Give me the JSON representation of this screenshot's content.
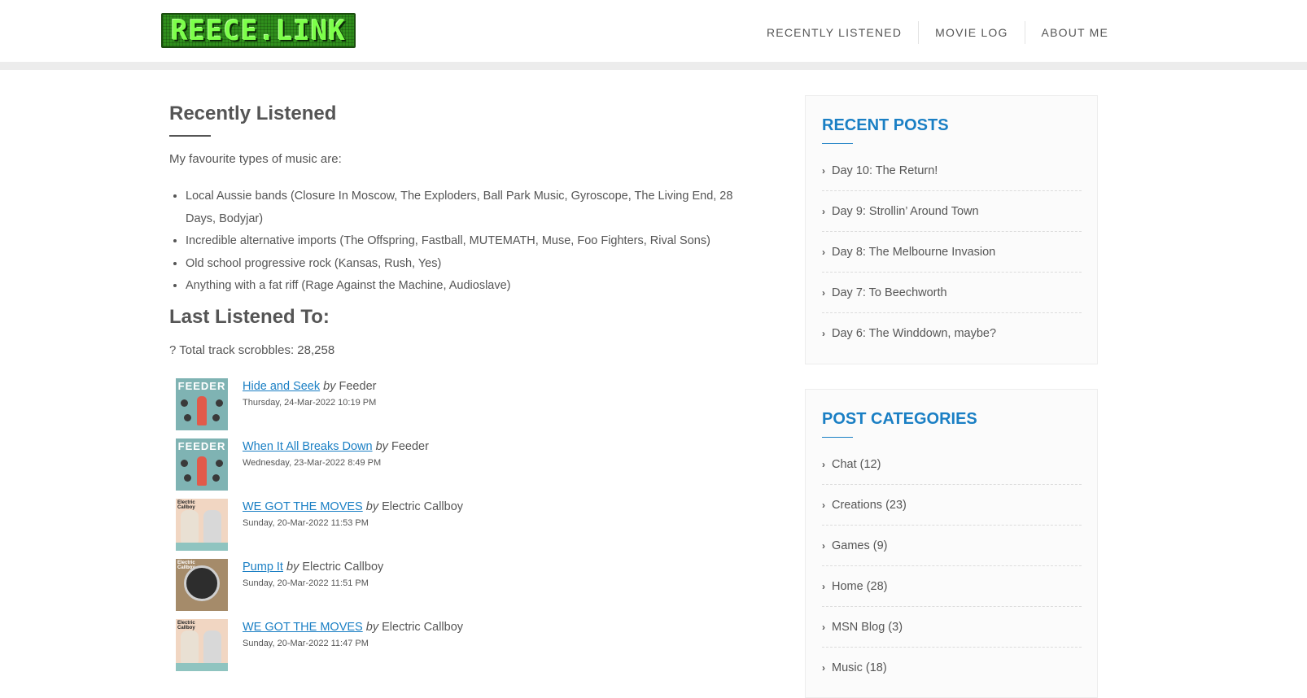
{
  "site": {
    "logo_text": "REECE.LINK"
  },
  "nav": [
    {
      "label": "RECENTLY LISTENED"
    },
    {
      "label": "MOVIE LOG"
    },
    {
      "label": "ABOUT ME"
    }
  ],
  "main": {
    "title": "Recently Listened",
    "intro": "My favourite types of music are:",
    "genres": [
      "Local Aussie bands (Closure In Moscow, The Exploders, Ball Park Music, Gyroscope, The Living End, 28 Days, Bodyjar)",
      "Incredible alternative imports (The Offspring, Fastball, MUTEMATH, Muse, Foo Fighters, Rival Sons)",
      "Old school progressive rock (Kansas, Rush, Yes)",
      "Anything with a fat riff (Rage Against the Machine, Audioslave)"
    ],
    "last_title": "Last Listened To:",
    "scrobbles": "? Total track scrobbles: 28,258",
    "by_word": "by",
    "tracks": [
      {
        "title": "Hide and Seek",
        "artist": "Feeder",
        "date": "Thursday, 24-Mar-2022 10:19 PM",
        "art": "feeder-album-art"
      },
      {
        "title": "When It All Breaks Down",
        "artist": "Feeder",
        "date": "Wednesday, 23-Mar-2022 8:49 PM",
        "art": "feeder-album-art"
      },
      {
        "title": "WE GOT THE MOVES",
        "artist": "Electric Callboy",
        "date": "Sunday, 20-Mar-2022 11:53 PM",
        "art": "electric-callboy-album-art"
      },
      {
        "title": "Pump It",
        "artist": "Electric Callboy",
        "date": "Sunday, 20-Mar-2022 11:51 PM",
        "art": "electric-callboy-pump-it-art"
      },
      {
        "title": "WE GOT THE MOVES",
        "artist": "Electric Callboy",
        "date": "Sunday, 20-Mar-2022 11:47 PM",
        "art": "electric-callboy-album-art"
      }
    ]
  },
  "sidebar": {
    "recent_title": "RECENT POSTS",
    "recent_posts": [
      "Day 10: The Return!",
      "Day 9: Strollin’ Around Town",
      "Day 8: The Melbourne Invasion",
      "Day 7: To Beechworth",
      "Day 6: The Winddown, maybe?"
    ],
    "categories_title": "POST CATEGORIES",
    "categories": [
      "Chat (12)",
      "Creations (23)",
      "Games (9)",
      "Home (28)",
      "MSN Blog (3)",
      "Music (18)"
    ]
  },
  "colors": {
    "accent": "#1a7fc4",
    "text": "#555555",
    "header_bar": "#ececec"
  }
}
